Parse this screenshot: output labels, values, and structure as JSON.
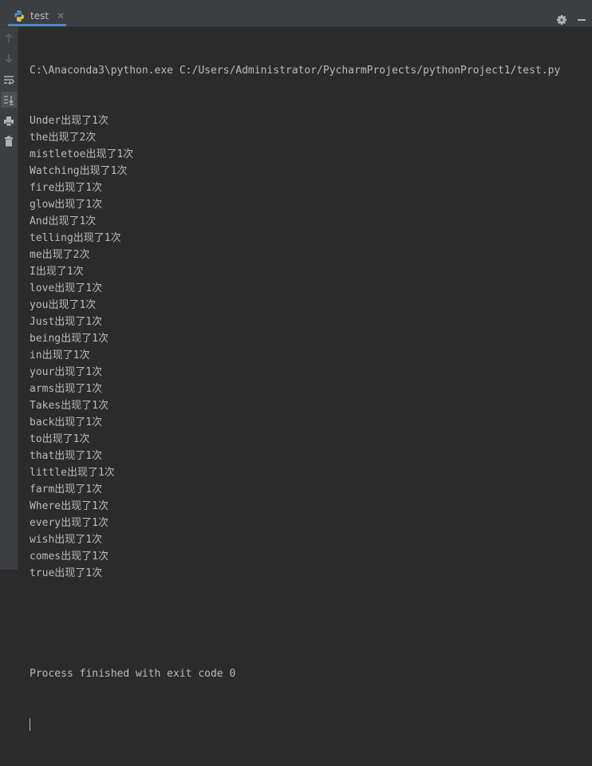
{
  "tab": {
    "label": "test",
    "close_glyph": "✕",
    "icon": "python-icon"
  },
  "toolbar": {
    "settings_icon": "gear-icon",
    "minimize_icon": "minimize-icon"
  },
  "sidebar": {
    "items": [
      {
        "icon": "arrow-up-icon"
      },
      {
        "icon": "arrow-down-icon"
      },
      {
        "icon": "soft-wrap-icon"
      },
      {
        "icon": "scroll-to-end-icon"
      },
      {
        "icon": "print-icon"
      },
      {
        "icon": "trash-icon"
      }
    ]
  },
  "console": {
    "command": "C:\\Anaconda3\\python.exe C:/Users/Administrator/PycharmProjects/pythonProject1/test.py",
    "lines": [
      "Under出现了1次",
      "the出现了2次",
      "mistletoe出现了1次",
      "Watching出现了1次",
      "fire出现了1次",
      "glow出现了1次",
      "And出现了1次",
      "telling出现了1次",
      "me出现了2次",
      "I出现了1次",
      "love出现了1次",
      "you出现了1次",
      "Just出现了1次",
      "being出现了1次",
      "in出现了1次",
      "your出现了1次",
      "arms出现了1次",
      "Takes出现了1次",
      "back出现了1次",
      "to出现了1次",
      "that出现了1次",
      "little出现了1次",
      "farm出现了1次",
      "Where出现了1次",
      "every出现了1次",
      "wish出现了1次",
      "comes出现了1次",
      "true出现了1次"
    ],
    "blank": "",
    "exit_message": "Process finished with exit code 0"
  }
}
